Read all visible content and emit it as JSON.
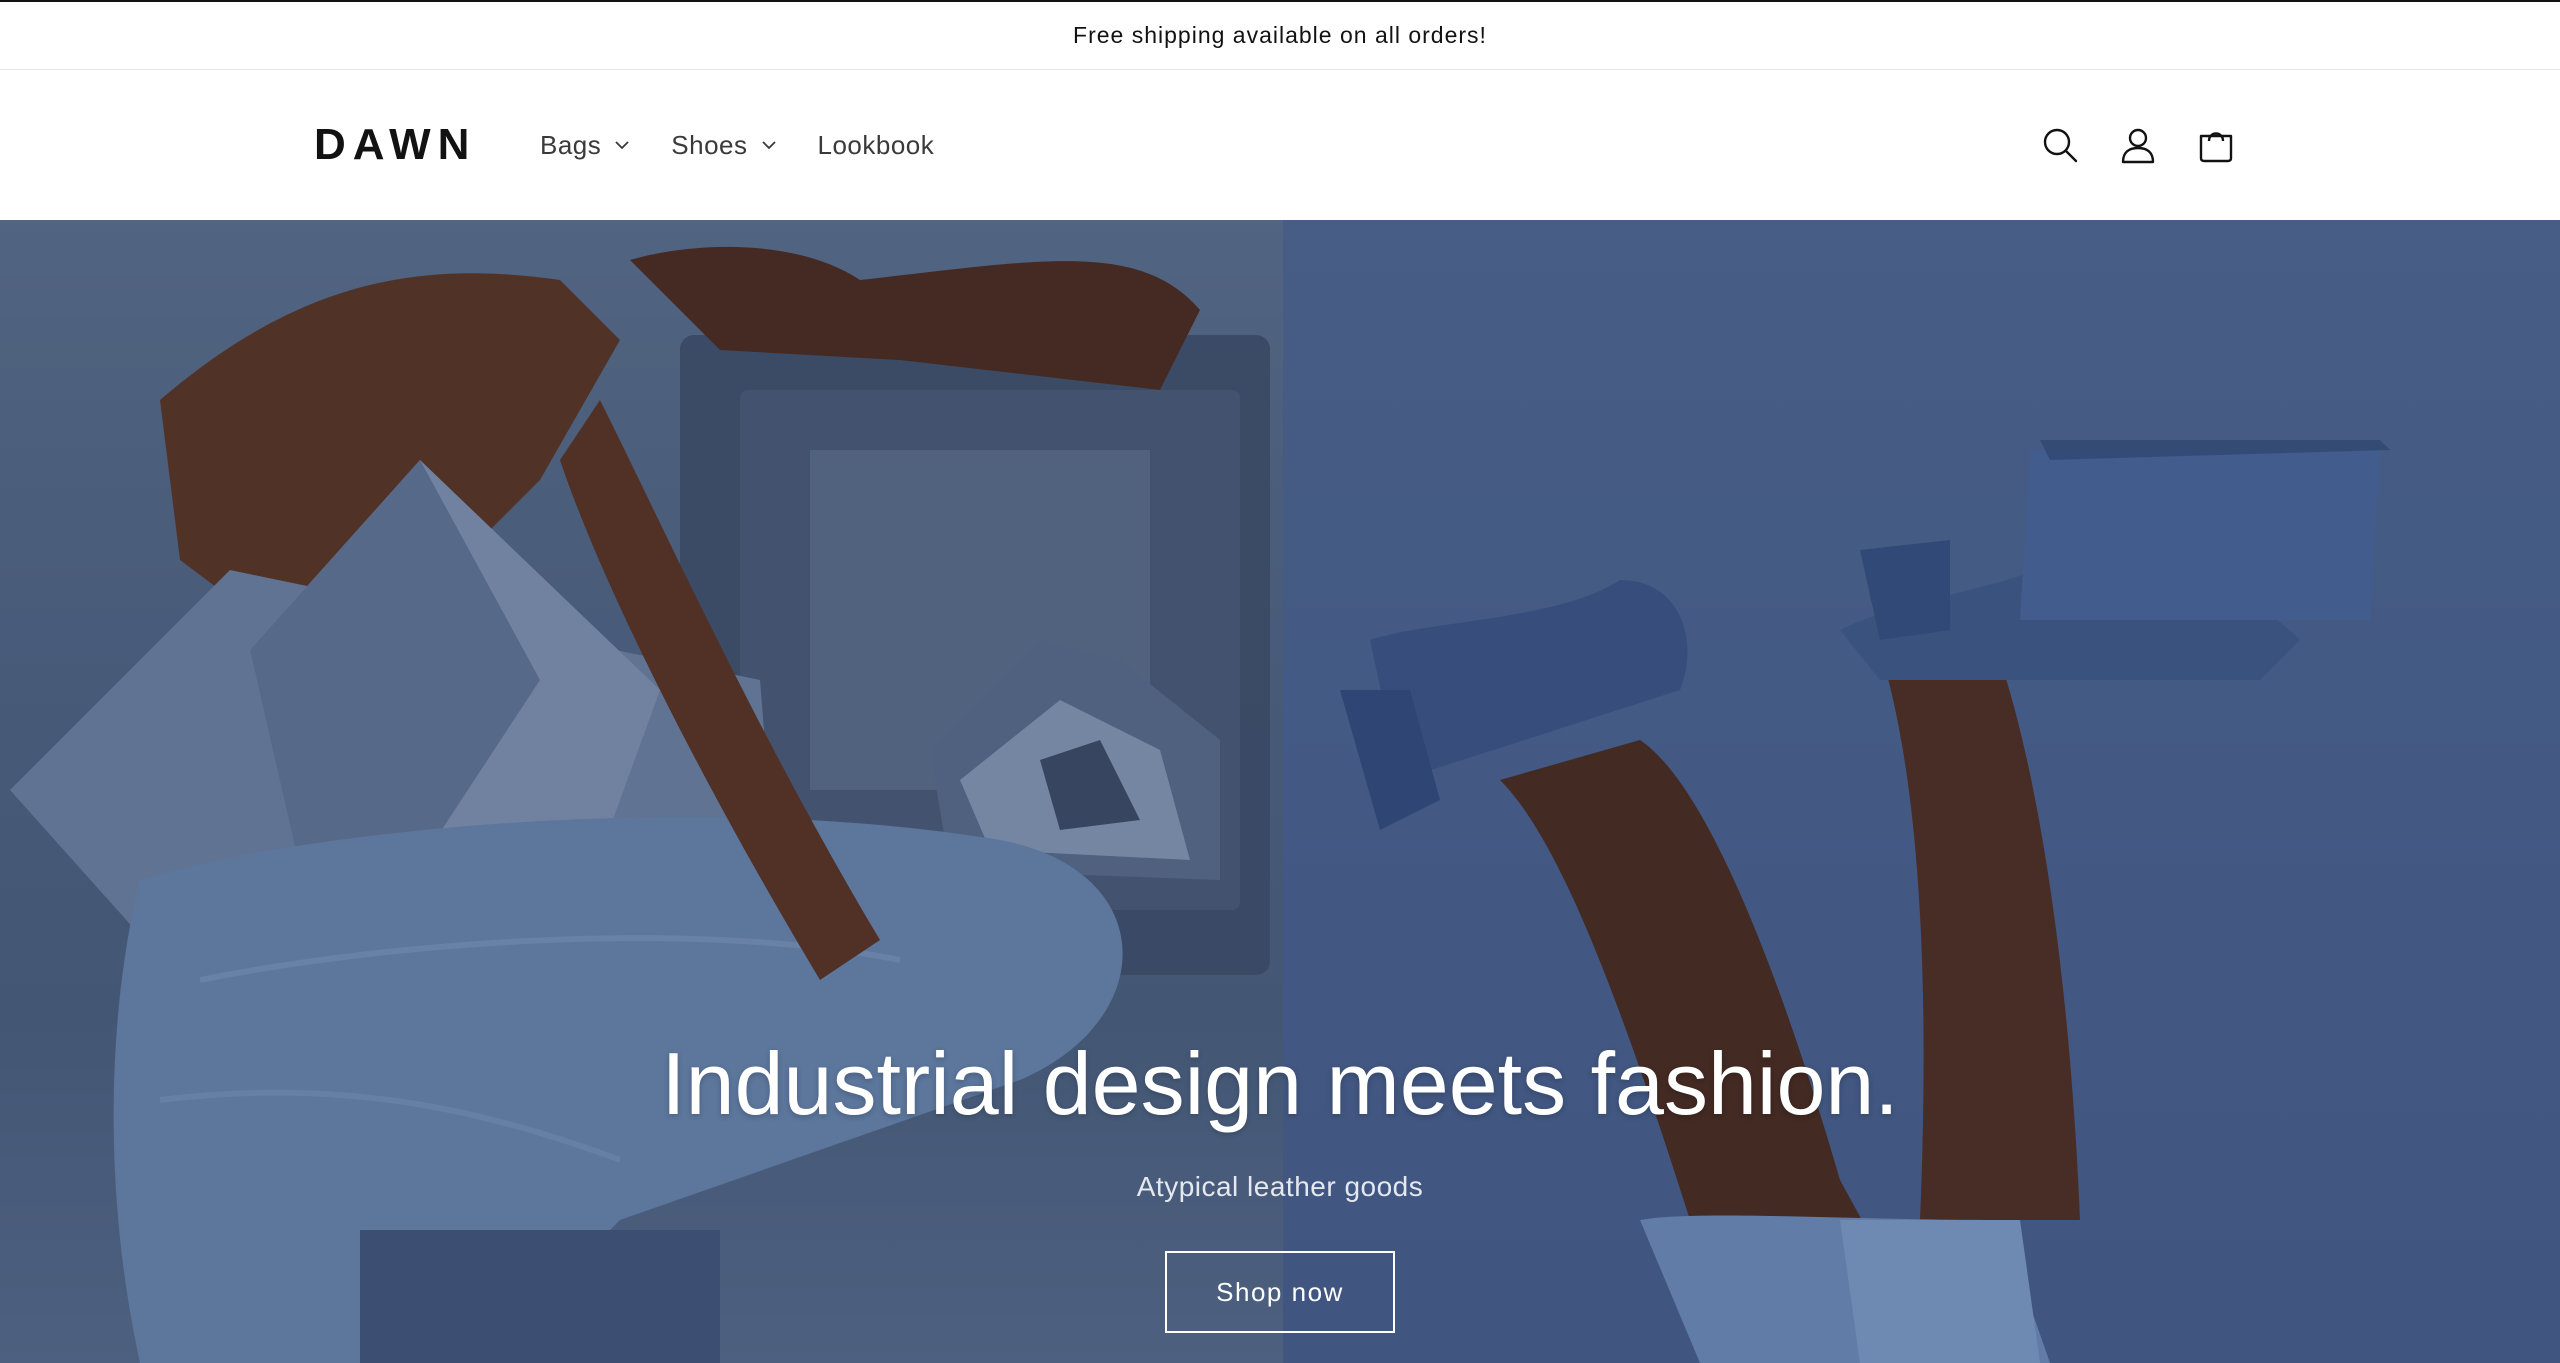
{
  "announcement": {
    "text": "Free shipping available on all orders!"
  },
  "header": {
    "logo": "DAWN",
    "nav": [
      {
        "label": "Bags",
        "has_dropdown": true
      },
      {
        "label": "Shoes",
        "has_dropdown": true
      },
      {
        "label": "Lookbook",
        "has_dropdown": false
      }
    ],
    "icons": [
      "search-icon",
      "account-icon",
      "cart-icon"
    ]
  },
  "hero": {
    "title": "Industrial design meets fashion.",
    "subtitle": "Atypical leather goods",
    "button_label": "Shop now"
  },
  "colors": {
    "text": "#121212",
    "hero_left_bg": "#52668a",
    "hero_right_bg": "#4a6190",
    "accent_white": "#ffffff"
  }
}
